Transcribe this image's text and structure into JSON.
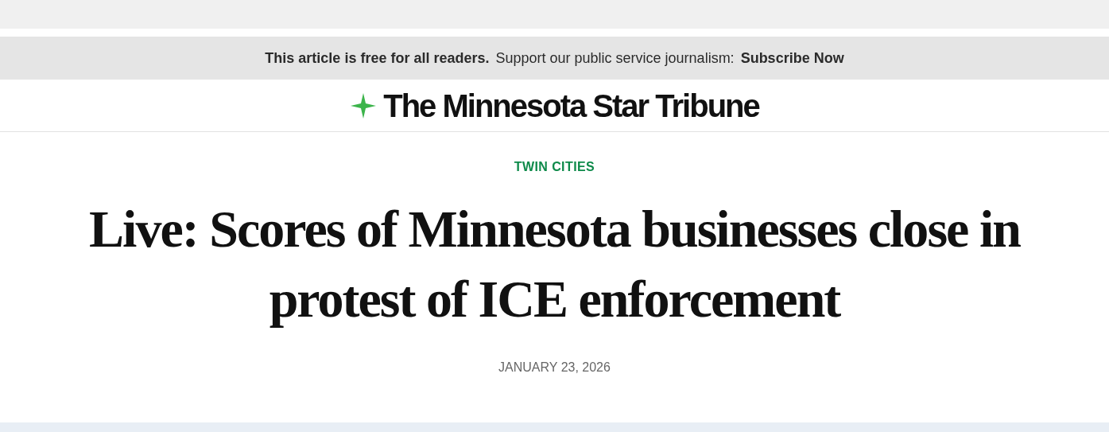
{
  "banner": {
    "lead": "This article is free for all readers.",
    "text": "Support our public service journalism:",
    "link": "Subscribe Now"
  },
  "masthead": {
    "title": "The Minnesota Star Tribune"
  },
  "article": {
    "section": "TWIN CITIES",
    "headline": "Live: Scores of Minnesota businesses close in protest of ICE enforcement",
    "date": "JANUARY 23, 2026"
  }
}
